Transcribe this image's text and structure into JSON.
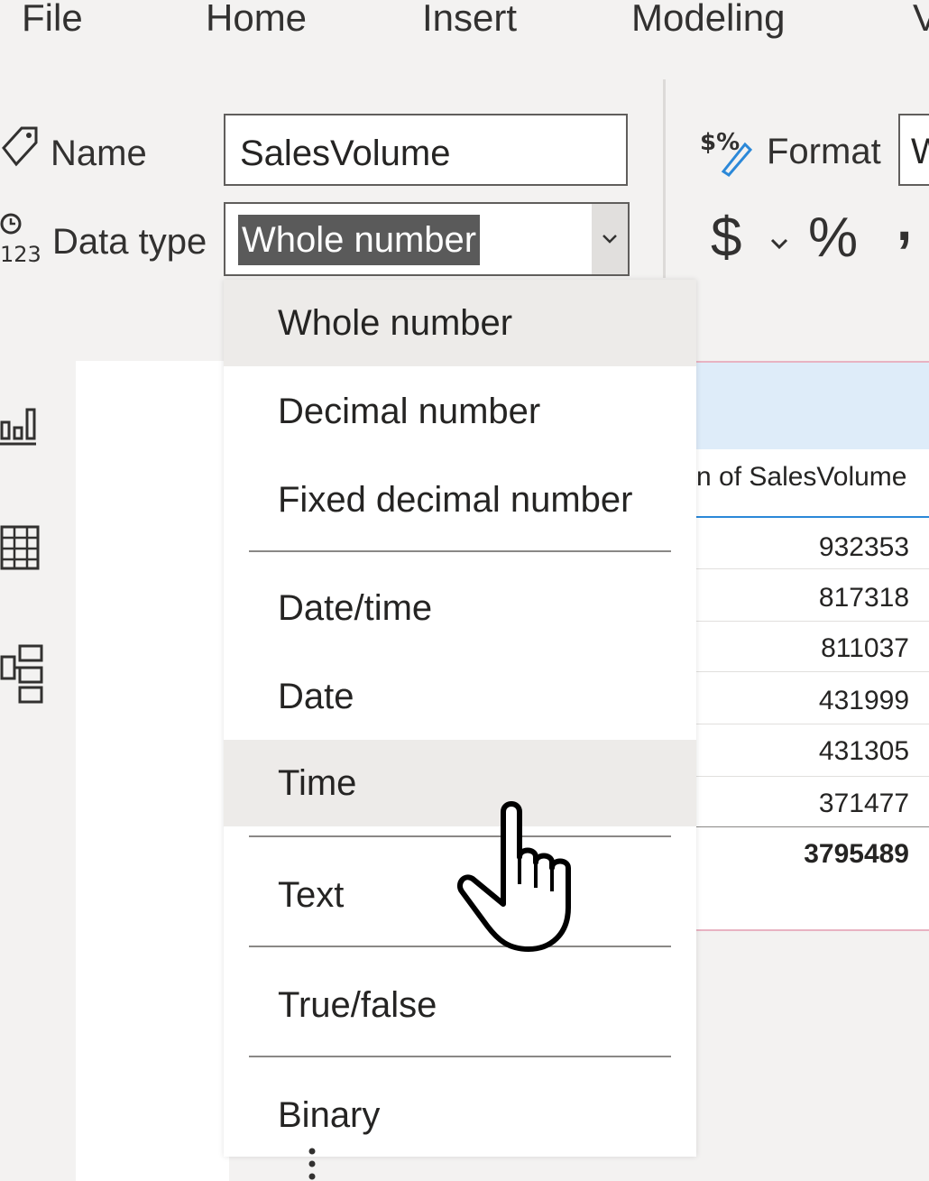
{
  "menu": [
    "File",
    "Home",
    "Insert",
    "Modeling",
    "V"
  ],
  "ribbon": {
    "name_label": "Name",
    "name_value": "SalesVolume",
    "datatype_label": "Data type",
    "datatype_value": "Whole number",
    "format_label": "Format",
    "format_value": "W",
    "currency_symbol": "$",
    "percent_symbol": "%",
    "comma_symbol": ","
  },
  "dropdown": {
    "options": [
      "Whole number",
      "Decimal number",
      "Fixed decimal number",
      "Date/time",
      "Date",
      "Time",
      "Text",
      "True/false",
      "Binary"
    ]
  },
  "table": {
    "column_header": "n of SalesVolume",
    "rows": [
      "932353",
      "817318",
      "811037",
      "431999",
      "431305",
      "371477"
    ],
    "total": "3795489"
  },
  "colors": {
    "accent": "#2b88d8",
    "highlight": "#edebe9",
    "selection": "#5a5a5a"
  }
}
